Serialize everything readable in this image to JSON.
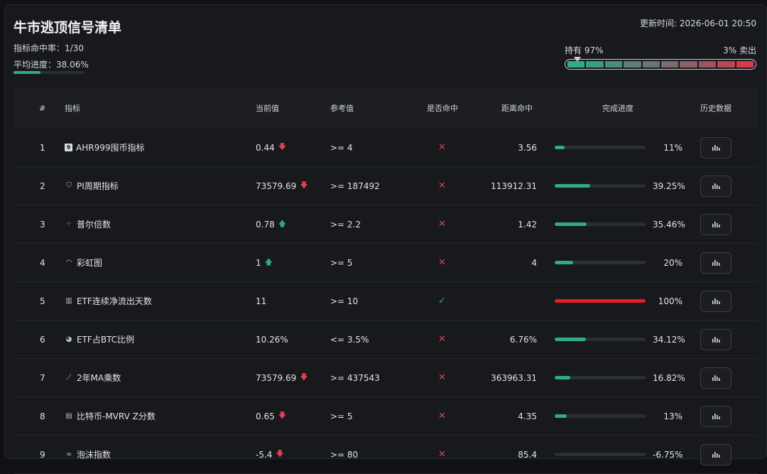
{
  "header": {
    "title": "牛市逃顶信号清单",
    "hit_rate": "指标命中率：1/30",
    "avg_progress": "平均进度：38.06%",
    "avg_progress_value": 38.06,
    "updated": "更新时间: 2026-06-01 20:50",
    "hold_label": "持有 97%",
    "sell_label": "3% 卖出",
    "segment_colors": [
      "#2faa8c",
      "#3a9c86",
      "#4a8c80",
      "#5d8079",
      "#6d7474",
      "#7c6a6f",
      "#8d5f68",
      "#a0545f",
      "#b84854",
      "#d83b48"
    ]
  },
  "columns": [
    "#",
    "指标",
    "当前值",
    "参考值",
    "是否命中",
    "距离命中",
    "完成进度",
    "历史数据"
  ],
  "rows": [
    {
      "idx": "1",
      "icon": "box-9-icon",
      "icon_glyph": "9",
      "name": "AHR999囤币指标",
      "current": "0.44",
      "trend": "down",
      "ref": ">= 4",
      "hit": false,
      "distance": "3.56",
      "progress": 11,
      "pct": "11%"
    },
    {
      "idx": "2",
      "icon": "pi-icon",
      "icon_glyph": "⛉",
      "name": "PI周期指标",
      "current": "73579.69",
      "trend": "down",
      "ref": ">= 187492",
      "hit": false,
      "distance": "113912.31",
      "progress": 39.25,
      "pct": "39.25%"
    },
    {
      "idx": "3",
      "icon": "scatter-icon",
      "icon_glyph": "⁘",
      "name": "普尔倍数",
      "current": "0.78",
      "trend": "up",
      "ref": ">= 2.2",
      "hit": false,
      "distance": "1.42",
      "progress": 35.46,
      "pct": "35.46%"
    },
    {
      "idx": "4",
      "icon": "rainbow-icon",
      "icon_glyph": "◠",
      "name": "彩虹图",
      "current": "1",
      "trend": "up",
      "ref": ">= 5",
      "hit": false,
      "distance": "4",
      "progress": 20,
      "pct": "20%"
    },
    {
      "idx": "5",
      "icon": "bar-chart-icon",
      "icon_glyph": "▥",
      "name": "ETF连续净流出天数",
      "current": "11",
      "trend": "",
      "ref": ">= 10",
      "hit": true,
      "distance": "",
      "progress": 100,
      "pct": "100%"
    },
    {
      "idx": "6",
      "icon": "pie-chart-icon",
      "icon_glyph": "◕",
      "name": "ETF占BTC比例",
      "current": "10.26%",
      "trend": "",
      "ref": "<= 3.5%",
      "hit": false,
      "distance": "6.76%",
      "progress": 34.12,
      "pct": "34.12%"
    },
    {
      "idx": "7",
      "icon": "line-chart-icon",
      "icon_glyph": "⟋",
      "name": "2年MA乘数",
      "current": "73579.69",
      "trend": "down",
      "ref": ">= 437543",
      "hit": false,
      "distance": "363963.31",
      "progress": 16.82,
      "pct": "16.82%"
    },
    {
      "idx": "8",
      "icon": "clipboard-icon",
      "icon_glyph": "▤",
      "name": "比特币-MVRV Z分数",
      "current": "0.65",
      "trend": "down",
      "ref": ">= 5",
      "hit": false,
      "distance": "4.35",
      "progress": 13,
      "pct": "13%"
    },
    {
      "idx": "9",
      "icon": "bubble-icon",
      "icon_glyph": "∞",
      "name": "泡沫指数",
      "current": "-5.4",
      "trend": "down",
      "ref": ">= 80",
      "hit": false,
      "distance": "85.4",
      "progress": 0,
      "pct": "-6.75%"
    }
  ],
  "glyphs": {
    "down": "🡇",
    "up": "🡅",
    "cross": "✕",
    "check": "✓"
  },
  "colors": {
    "accent": "#2faa8c",
    "danger": "#e0414f",
    "complete": "#e81c23"
  }
}
